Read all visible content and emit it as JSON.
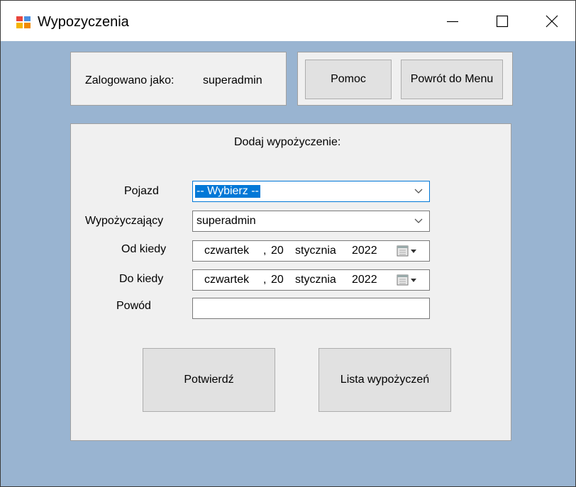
{
  "window": {
    "title": "Wypozyczenia"
  },
  "login": {
    "label": "Zalogowano jako:",
    "username": "superadmin"
  },
  "toolbar": {
    "help_label": "Pomoc",
    "back_label": "Powrót do Menu"
  },
  "form": {
    "heading": "Dodaj wypożyczenie:",
    "vehicle_label": "Pojazd",
    "vehicle_value": "-- Wybierz --",
    "borrower_label": "Wypożyczający",
    "borrower_value": "superadmin",
    "from_label": "Od kiedy",
    "to_label": "Do kiedy",
    "reason_label": "Powód",
    "reason_value": "",
    "from_date": {
      "weekday": "czwartek",
      "sep": ",",
      "day": "20",
      "month": "stycznia",
      "year": "2022"
    },
    "to_date": {
      "weekday": "czwartek",
      "sep": ",",
      "day": "20",
      "month": "stycznia",
      "year": "2022"
    },
    "confirm_label": "Potwierdź",
    "list_label": "Lista wypożyczeń"
  },
  "colors": {
    "client_background": "#99b4d1",
    "panel_background": "#f0f0f0",
    "focus_border": "#0078d7",
    "selection": "#0078d7"
  },
  "icons": {
    "app": "app-window-icon",
    "minimize": "minimize-icon",
    "maximize": "maximize-icon",
    "close": "close-icon",
    "dropdown": "chevron-down-icon",
    "calendar": "calendar-icon"
  }
}
